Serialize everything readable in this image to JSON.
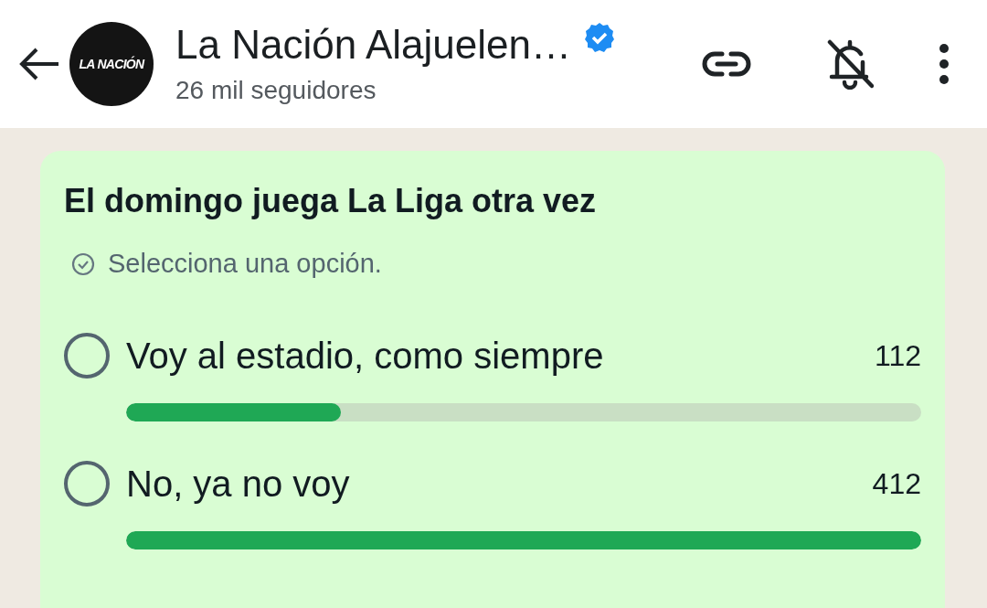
{
  "channel": {
    "logo_text": "LA NACIÓN",
    "name": "La Nación Alajuelen…",
    "verified": true,
    "followers": "26 mil seguidores"
  },
  "poll": {
    "question": "El domingo juega La Liga otra vez",
    "hint": "Selecciona una opción.",
    "options": [
      {
        "label": "Voy al estadio, como siempre",
        "count": "112",
        "selected": false,
        "level": 0.27
      },
      {
        "label": "No, ya no voy",
        "count": "412",
        "selected": false,
        "level": 1.0
      }
    ]
  }
}
